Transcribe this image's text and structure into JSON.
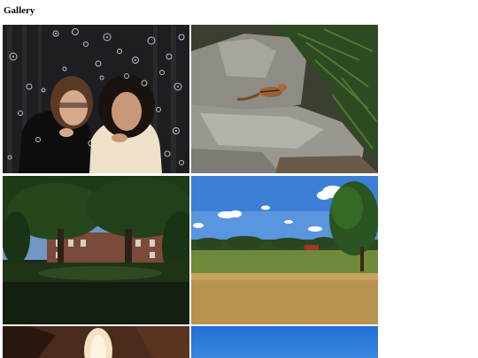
{
  "page": {
    "title": "Gallery"
  },
  "photos": [
    {
      "subject": "two-people-blowing-kisses-with-bubbles"
    },
    {
      "subject": "chipmunk-on-rocks-with-fern"
    },
    {
      "subject": "trees-in-front-of-brick-building"
    },
    {
      "subject": "field-with-tree-and-blue-sky"
    },
    {
      "subject": "cave-opening"
    },
    {
      "subject": "clear-blue-sky"
    }
  ]
}
